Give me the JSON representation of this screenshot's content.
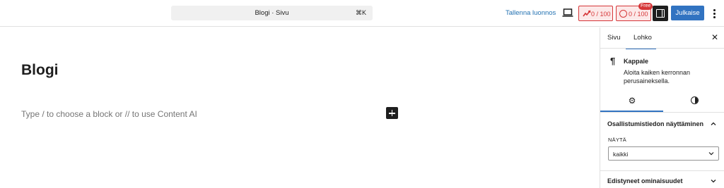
{
  "header": {
    "command_title": "Blogi · Sivu",
    "command_shortcut": "⌘K",
    "save_draft_label": "Tallenna luonnos",
    "score1": "0 / 100",
    "score2": "0 / 100",
    "free_badge": "Free",
    "publish_label": "Julkaise",
    "icons": {
      "device": "laptop-icon",
      "score1": "seo-score-icon",
      "score2": "readability-score-icon",
      "sidebar": "sidebar-toggle-icon",
      "more": "more-vertical-icon"
    }
  },
  "editor": {
    "post_title": "Blogi",
    "placeholder": "Type / to choose a block or // to use Content AI"
  },
  "sidebar": {
    "tabs": [
      "Sivu",
      "Lohko"
    ],
    "active_tab": "Lohko",
    "block": {
      "name": "Kappale",
      "description": "Aloita kaiken kerronnan perusaineksella."
    },
    "panel_title": "Osallistumistiedon näyttäminen",
    "show_label": "NÄYTÄ",
    "show_value": "kaikki",
    "advanced_title": "Edistyneet ominaisuudet"
  },
  "colors": {
    "accent": "#3173c1",
    "error": "#d63638",
    "link": "#2271b1"
  }
}
